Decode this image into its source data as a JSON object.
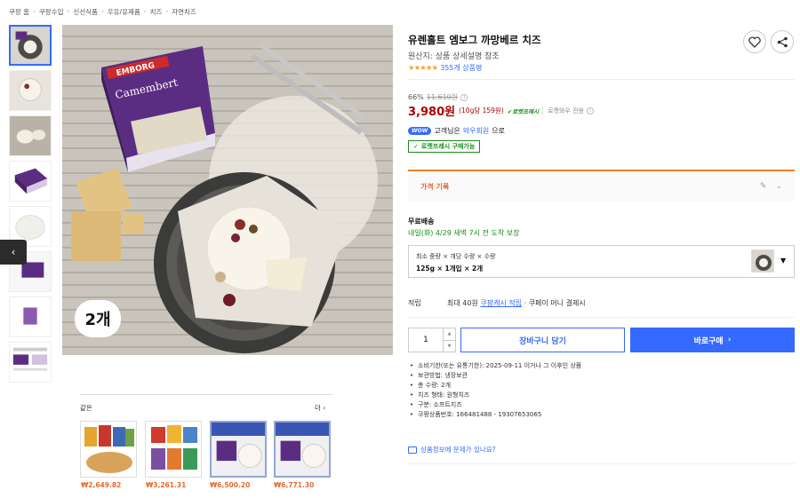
{
  "breadcrumb": [
    "쿠팡 홈",
    "쿠팡수입",
    "신선식품",
    "우유/유제품",
    "치즈",
    "자연치즈"
  ],
  "product": {
    "title": "유렌홀트 엠보그 까망베르 치즈",
    "origin": "원산지: 상품 상세설명 참조",
    "stars": "★★★★★",
    "rating": 5,
    "review_count": "355개 상품평",
    "packaging_brand": "EMBORG",
    "packaging_name": "Camembert",
    "image_badge": "2개"
  },
  "price": {
    "discount": "66%",
    "original": "11,610원",
    "sale": "3,980원",
    "unit": "(10g당 159원)",
    "rocket_fresh": "로켓프레시",
    "wow_only": "로켓와우 전용"
  },
  "wow": {
    "badge": "WOW",
    "text_before": "고객님은",
    "link": "와우회원",
    "text_after": "으로",
    "fresh_badge": "로켓프레시 구매가능"
  },
  "price_history": {
    "label": "가격 기록"
  },
  "shipping": {
    "title": "무료배송",
    "eta": "내일(화) 4/29 새벽 7시 전 도착 보장"
  },
  "option": {
    "label": "최소 중량 × 개당 수량 × 수량",
    "value": "125g × 1개입 × 2개"
  },
  "reward": {
    "label": "적립",
    "prefix": "최대 40원",
    "link": "쿠팡캐시 적립",
    "suffix": "· 쿠페이 머니 결제시"
  },
  "purchase": {
    "quantity": "1",
    "cart_label": "장바구니 담기",
    "buy_label": "바로구매"
  },
  "specs": [
    "소비기한(또는 유통기한): 2025-09-11 이거나 그 이후인 상품",
    "보관방법: 냉장보관",
    "총 수량: 2개",
    "치즈 형태: 원형치즈",
    "구분: 소프트치즈",
    "쿠팡상품번호: 166481488 - 19307653065"
  ],
  "report_label": "상품정보에 문제가 있나요?",
  "related": {
    "title": "같은",
    "more": "더",
    "items": [
      {
        "price": "₩2,649.82"
      },
      {
        "price": "₩3,261.31"
      },
      {
        "price": "₩6,500.20"
      },
      {
        "price": "₩6,771.30"
      }
    ]
  },
  "colors": {
    "accent_blue": "#346aff",
    "price_red": "#ae0000",
    "fresh_green": "#1a8c1a",
    "history_orange": "#f27d22"
  }
}
